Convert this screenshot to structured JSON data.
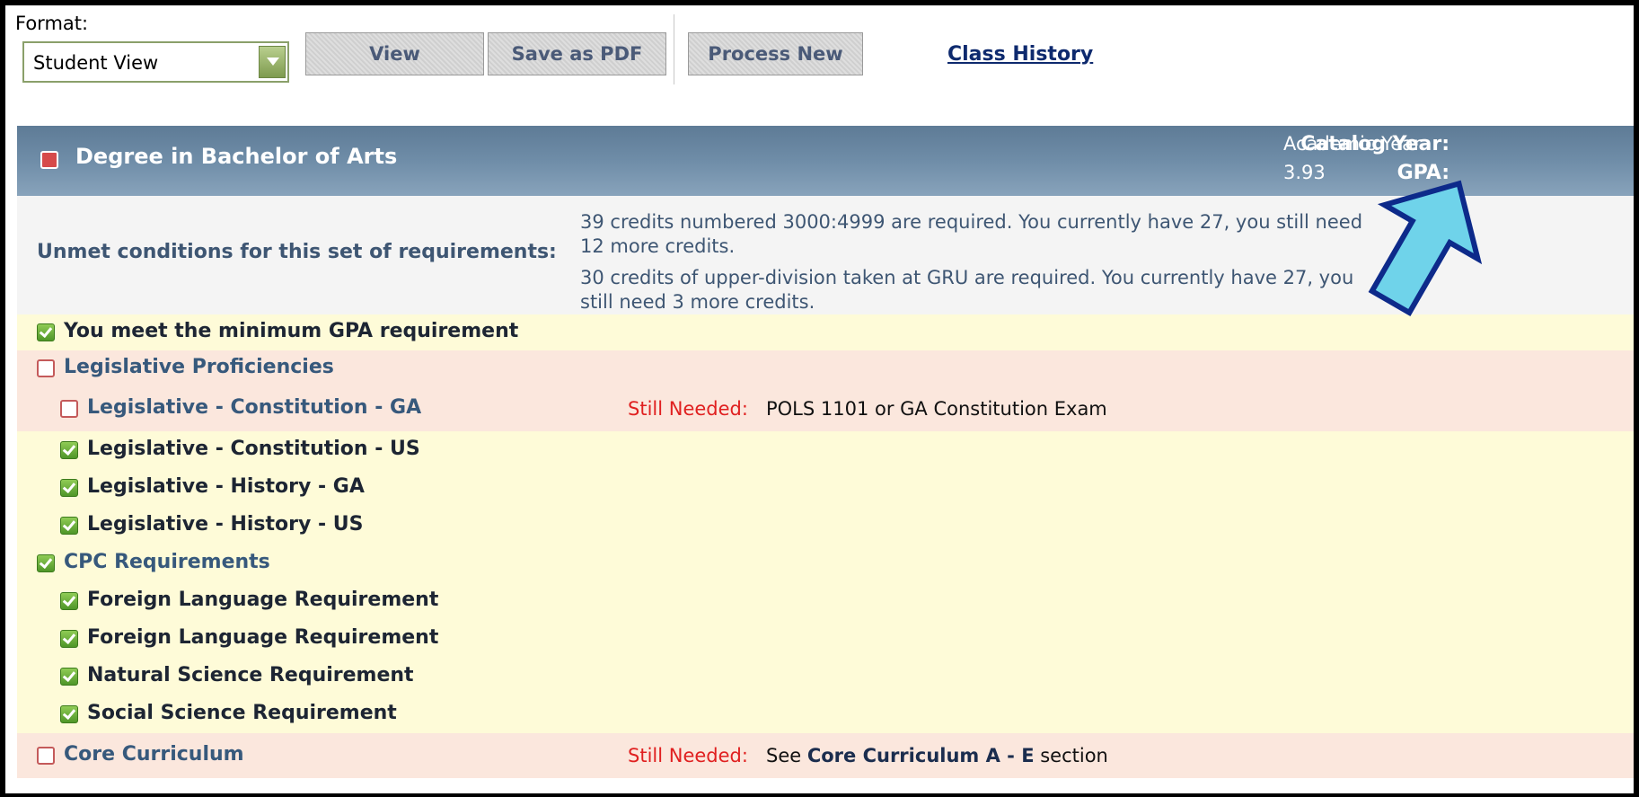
{
  "toolbar": {
    "format_label": "Format:",
    "format_value": "Student View",
    "view_button": "View",
    "save_pdf_button": "Save as PDF",
    "process_new_button": "Process New",
    "class_history_link": "Class History"
  },
  "degree": {
    "title": "Degree in Bachelor of Arts",
    "catalog_year_label": "Catalog Year:",
    "catalog_year_value": "Academic Year",
    "gpa_label": "GPA:",
    "gpa_value": "3.93"
  },
  "unmet": {
    "title": "Unmet conditions for this set of requirements:",
    "conditions": [
      "39 credits numbered 3000:4999 are required. You currently have 27, you still need 12 more credits.",
      "30 credits of upper-division taken at GRU are required. You currently have 27, you still need 3 more credits."
    ]
  },
  "rows": [
    {
      "label": "You meet the minimum GPA requirement",
      "status": "met"
    },
    {
      "label": "Legislative Proficiencies",
      "status": "unmet"
    },
    {
      "label": "Legislative - Constitution - GA",
      "status": "unmet",
      "still_needed_label": "Still Needed:",
      "still_needed_text": "POLS 1101 or GA Constitution Exam"
    },
    {
      "label": "Legislative - Constitution - US",
      "status": "met"
    },
    {
      "label": "Legislative - History - GA",
      "status": "met"
    },
    {
      "label": "Legislative - History - US",
      "status": "met"
    },
    {
      "label": "CPC Requirements",
      "status": "met"
    },
    {
      "label": "Foreign Language Requirement",
      "status": "met"
    },
    {
      "label": "Foreign Language Requirement",
      "status": "met"
    },
    {
      "label": "Natural Science Requirement",
      "status": "met"
    },
    {
      "label": "Social Science Requirement",
      "status": "met"
    },
    {
      "label": "Core Curriculum",
      "status": "unmet",
      "still_needed_label": "Still Needed:",
      "still_needed_prefix": "See",
      "still_needed_link": "Core Curriculum A - E",
      "still_needed_suffix": "section"
    }
  ],
  "colors": {
    "header_blue": "#6f8da8",
    "met_green": "#5aa52e",
    "unmet_red": "#d64a4a",
    "still_needed_red": "#e02020",
    "arrow_fill": "#6fd3ea",
    "arrow_stroke": "#0d2a8a"
  }
}
